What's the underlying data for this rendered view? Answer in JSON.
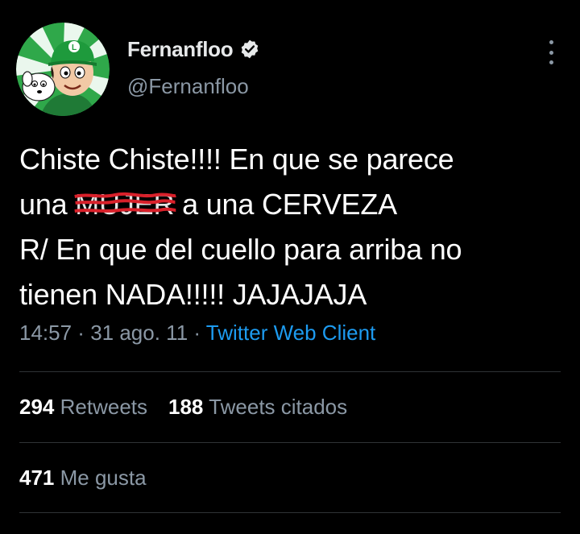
{
  "user": {
    "display_name": "Fernanfloo",
    "handle": "@Fernanfloo",
    "verified": true,
    "avatar_icon": "cartoon-avatar-green-cap"
  },
  "more_icon": "more-vertical-icon",
  "tweet": {
    "line1": "Chiste Chiste!!!! En que se parece",
    "line2_pre": "una ",
    "line2_scribbled": "MUJER",
    "line2_post": " a una CERVEZA",
    "line3": "R/ En que del cuello para arriba no",
    "line4": "tienen NADA!!!!! JAJAJAJA",
    "scribble_color": "#d8202a"
  },
  "meta": {
    "time": "14:57",
    "sep1": " · ",
    "date": "31 ago. 11",
    "sep2": " · ",
    "client": "Twitter Web Client"
  },
  "stats": {
    "retweets_count": "294",
    "retweets_label": "Retweets",
    "quotes_count": "188",
    "quotes_label": "Tweets citados",
    "likes_count": "471",
    "likes_label": "Me gusta"
  },
  "colors": {
    "background": "#000000",
    "secondary_text": "#8b98a5",
    "link": "#1d9bf0",
    "divider": "#2f3336"
  }
}
